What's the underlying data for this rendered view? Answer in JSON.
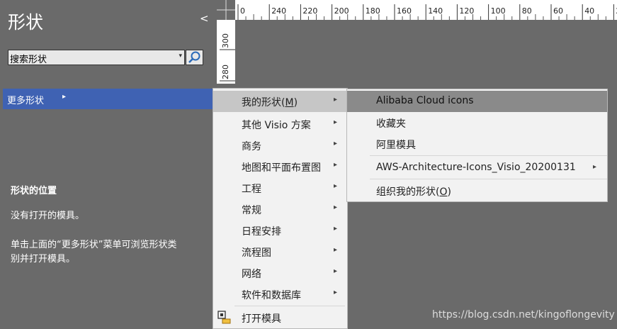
{
  "shapes_panel": {
    "title": "形状",
    "collapse_icon": "<",
    "search": {
      "value": "搜索形状",
      "dropdown_icon": "▾"
    },
    "more_shapes_label": "更多形状",
    "more_shapes_arrow": "▸",
    "location": {
      "title": "形状的位置",
      "line1": "没有打开的模具。",
      "line2": "单击上面的“更多形状”菜单可浏览形状类",
      "line3": "别并打开模具。"
    }
  },
  "ruler": {
    "top_ticks": [
      "0",
      "240",
      "220",
      "200",
      "180",
      "160",
      "140",
      "120",
      "100",
      "80",
      "60",
      "40",
      "20"
    ],
    "left_ticks": [
      "300",
      "280"
    ]
  },
  "menu1": {
    "items": [
      {
        "label": "我的形状(M)",
        "arrow": "▸"
      },
      {
        "label": "其他 Visio 方案",
        "arrow": "▸"
      },
      {
        "label": "商务",
        "arrow": "▸"
      },
      {
        "label": "地图和平面布置图",
        "arrow": "▸"
      },
      {
        "label": "工程",
        "arrow": "▸"
      },
      {
        "label": "常规",
        "arrow": "▸"
      },
      {
        "label": "日程安排",
        "arrow": "▸"
      },
      {
        "label": "流程图",
        "arrow": "▸"
      },
      {
        "label": "网络",
        "arrow": "▸"
      },
      {
        "label": "软件和数据库",
        "arrow": "▸"
      }
    ],
    "open_stencil": "打开模具"
  },
  "menu2": {
    "items": [
      {
        "label": "Alibaba Cloud icons"
      },
      {
        "label": "收藏夹"
      },
      {
        "label": "阿里模具"
      },
      {
        "label": "AWS-Architecture-Icons_Visio_20200131",
        "arrow": "▸"
      },
      {
        "label": "组织我的形状(O)"
      }
    ]
  },
  "watermark": "https://blog.csdn.net/kingoflongevity",
  "colors": {
    "background": "#6a6a6a",
    "accent": "#3f62b3",
    "menu_bg": "#f2f2f2",
    "menu_highlight": "#c6c6c6"
  }
}
